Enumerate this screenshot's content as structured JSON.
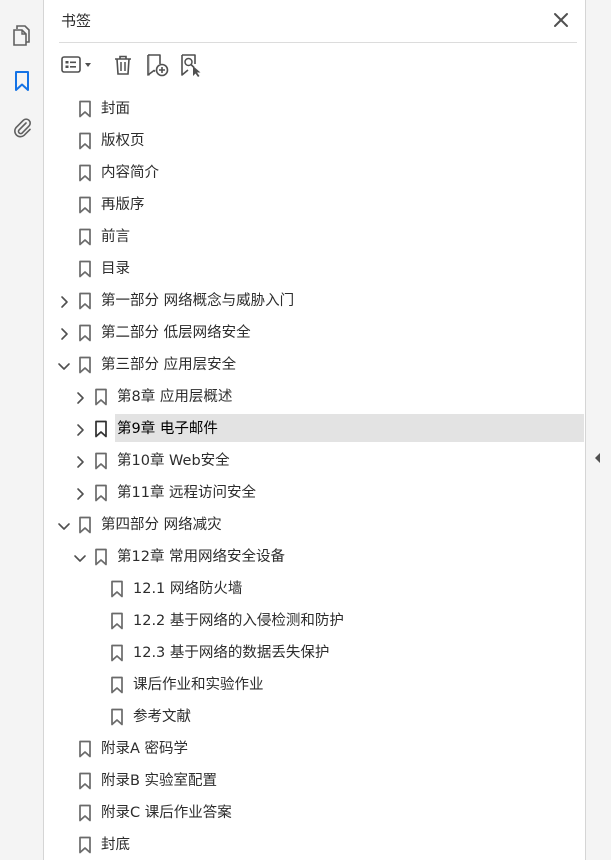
{
  "rail": {
    "icons": [
      "pages-icon",
      "bookmark-icon",
      "attachment-icon"
    ],
    "active": "bookmark-icon",
    "accent": "#1473e6"
  },
  "panel": {
    "title": "书签",
    "toolbar": [
      "options-menu-icon",
      "delete-bookmark-icon",
      "new-bookmark-icon",
      "bookmark-search-icon"
    ]
  },
  "bookmarks": [
    {
      "label": "封面",
      "level": 0,
      "expander": "none"
    },
    {
      "label": "版权页",
      "level": 0,
      "expander": "none"
    },
    {
      "label": "内容简介",
      "level": 0,
      "expander": "none"
    },
    {
      "label": "再版序",
      "level": 0,
      "expander": "none"
    },
    {
      "label": "前言",
      "level": 0,
      "expander": "none"
    },
    {
      "label": "目录",
      "level": 0,
      "expander": "none"
    },
    {
      "label": "第一部分 网络概念与威胁入门",
      "level": 0,
      "expander": "collapsed"
    },
    {
      "label": "第二部分 低层网络安全",
      "level": 0,
      "expander": "collapsed"
    },
    {
      "label": "第三部分 应用层安全",
      "level": 0,
      "expander": "expanded"
    },
    {
      "label": "第8章 应用层概述",
      "level": 1,
      "expander": "collapsed"
    },
    {
      "label": "第9章 电子邮件",
      "level": 1,
      "expander": "collapsed",
      "selected": true
    },
    {
      "label": "第10章 Web安全",
      "level": 1,
      "expander": "collapsed"
    },
    {
      "label": "第11章 远程访问安全",
      "level": 1,
      "expander": "collapsed"
    },
    {
      "label": "第四部分 网络减灾",
      "level": 0,
      "expander": "expanded"
    },
    {
      "label": "第12章 常用网络安全设备",
      "level": 1,
      "expander": "expanded"
    },
    {
      "label": "12.1 网络防火墙",
      "level": 2,
      "expander": "none"
    },
    {
      "label": "12.2 基于网络的入侵检测和防护",
      "level": 2,
      "expander": "none"
    },
    {
      "label": "12.3 基于网络的数据丢失保护",
      "level": 2,
      "expander": "none"
    },
    {
      "label": "课后作业和实验作业",
      "level": 2,
      "expander": "none"
    },
    {
      "label": "参考文献",
      "level": 2,
      "expander": "none"
    },
    {
      "label": "附录A 密码学",
      "level": 0,
      "expander": "none"
    },
    {
      "label": "附录B 实验室配置",
      "level": 0,
      "expander": "none"
    },
    {
      "label": "附录C 课后作业答案",
      "level": 0,
      "expander": "none"
    },
    {
      "label": "封底",
      "level": 0,
      "expander": "none"
    }
  ]
}
